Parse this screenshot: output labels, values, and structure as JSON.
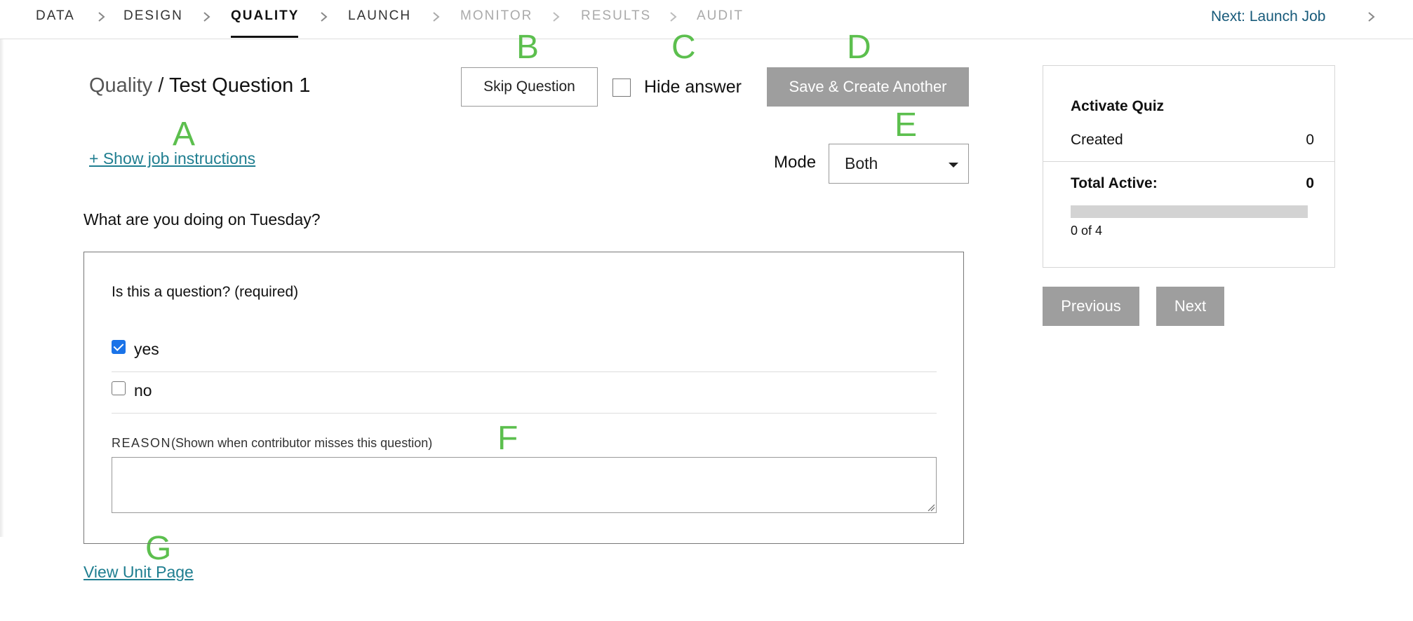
{
  "nav": {
    "steps": [
      "DATA",
      "DESIGN",
      "QUALITY",
      "LAUNCH",
      "MONITOR",
      "RESULTS",
      "AUDIT"
    ],
    "active_step": "QUALITY",
    "disabled_steps": [
      "MONITOR",
      "RESULTS",
      "AUDIT"
    ],
    "next_label": "Next: Launch Job"
  },
  "header": {
    "crumb_parent": "Quality",
    "crumb_separator": "/",
    "crumb_current": "Test Question 1",
    "skip_label": "Skip Question",
    "hide_answer_label": "Hide answer",
    "hide_answer_checked": false,
    "save_label": "Save & Create Another"
  },
  "instructions_link": "+ Show job instructions",
  "mode": {
    "label": "Mode",
    "value": "Both"
  },
  "question": {
    "title": "What are you doing on Tuesday?",
    "prompt": "Is this a question? (required)",
    "options": [
      {
        "label": "yes",
        "checked": true
      },
      {
        "label": "no",
        "checked": false
      }
    ],
    "reason_caps": "REASON",
    "reason_hint": "(Shown when contributor misses this question)",
    "reason_value": ""
  },
  "view_unit_link": "View Unit Page",
  "quiz": {
    "title": "Activate Quiz",
    "created_label": "Created",
    "created_value": "0",
    "total_label": "Total Active:",
    "total_value": "0",
    "progress_fraction": 0,
    "progress_text": "0 of 4"
  },
  "pagination": {
    "previous_label": "Previous",
    "next_label": "Next"
  },
  "annotations": [
    "A",
    "B",
    "C",
    "D",
    "E",
    "F",
    "G"
  ],
  "colors": {
    "link": "#1f7e90",
    "nav_next": "#175a7a",
    "button_gray": "#9e9e9e",
    "annotation_green": "#5cbf4e",
    "checkbox_blue": "#1a73e8"
  }
}
